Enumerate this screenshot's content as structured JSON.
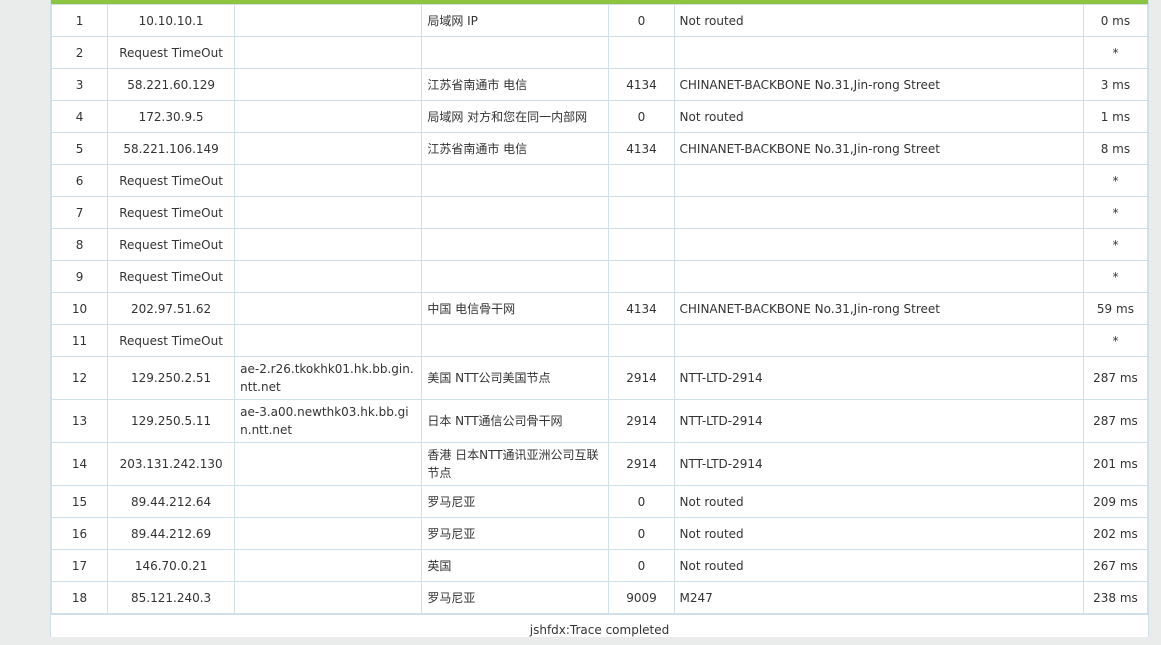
{
  "rows": [
    {
      "hop": "1",
      "ip": "10.10.10.1",
      "host": "",
      "location": "局域网 IP",
      "asn": "0",
      "network": "Not routed",
      "time": "0 ms"
    },
    {
      "hop": "2",
      "ip": "Request TimeOut",
      "host": "",
      "location": "",
      "asn": "",
      "network": "",
      "time": "*"
    },
    {
      "hop": "3",
      "ip": "58.221.60.129",
      "host": "",
      "location": "江苏省南通市 电信",
      "asn": "4134",
      "network": "CHINANET-BACKBONE No.31,Jin-rong Street",
      "time": "3 ms"
    },
    {
      "hop": "4",
      "ip": "172.30.9.5",
      "host": "",
      "location": "局域网 对方和您在同一内部网",
      "asn": "0",
      "network": "Not routed",
      "time": "1 ms"
    },
    {
      "hop": "5",
      "ip": "58.221.106.149",
      "host": "",
      "location": "江苏省南通市 电信",
      "asn": "4134",
      "network": "CHINANET-BACKBONE No.31,Jin-rong Street",
      "time": "8 ms"
    },
    {
      "hop": "6",
      "ip": "Request TimeOut",
      "host": "",
      "location": "",
      "asn": "",
      "network": "",
      "time": "*"
    },
    {
      "hop": "7",
      "ip": "Request TimeOut",
      "host": "",
      "location": "",
      "asn": "",
      "network": "",
      "time": "*"
    },
    {
      "hop": "8",
      "ip": "Request TimeOut",
      "host": "",
      "location": "",
      "asn": "",
      "network": "",
      "time": "*"
    },
    {
      "hop": "9",
      "ip": "Request TimeOut",
      "host": "",
      "location": "",
      "asn": "",
      "network": "",
      "time": "*"
    },
    {
      "hop": "10",
      "ip": "202.97.51.62",
      "host": "",
      "location": "中国 电信骨干网",
      "asn": "4134",
      "network": "CHINANET-BACKBONE No.31,Jin-rong Street",
      "time": "59 ms"
    },
    {
      "hop": "11",
      "ip": "Request TimeOut",
      "host": "",
      "location": "",
      "asn": "",
      "network": "",
      "time": "*"
    },
    {
      "hop": "12",
      "ip": "129.250.2.51",
      "host": "ae-2.r26.tkokhk01.hk.bb.gin.ntt.net",
      "location": "美国 NTT公司美国节点",
      "asn": "2914",
      "network": "NTT-LTD-2914",
      "time": "287 ms"
    },
    {
      "hop": "13",
      "ip": "129.250.5.11",
      "host": "ae-3.a00.newthk03.hk.bb.gin.ntt.net",
      "location": "日本 NTT通信公司骨干网",
      "asn": "2914",
      "network": "NTT-LTD-2914",
      "time": "287 ms"
    },
    {
      "hop": "14",
      "ip": "203.131.242.130",
      "host": "",
      "location": "香港 日本NTT通讯亚洲公司互联节点",
      "asn": "2914",
      "network": "NTT-LTD-2914",
      "time": "201 ms"
    },
    {
      "hop": "15",
      "ip": "89.44.212.64",
      "host": "",
      "location": "罗马尼亚",
      "asn": "0",
      "network": "Not routed",
      "time": "209 ms"
    },
    {
      "hop": "16",
      "ip": "89.44.212.69",
      "host": "",
      "location": "罗马尼亚",
      "asn": "0",
      "network": "Not routed",
      "time": "202 ms"
    },
    {
      "hop": "17",
      "ip": "146.70.0.21",
      "host": "",
      "location": "英国",
      "asn": "0",
      "network": "Not routed",
      "time": "267 ms"
    },
    {
      "hop": "18",
      "ip": "85.121.240.3",
      "host": "",
      "location": "罗马尼亚",
      "asn": "9009",
      "network": "M247",
      "time": "238 ms"
    }
  ],
  "footer": "jshfdx:Trace completed",
  "colors": {
    "accent": "#8cc43f",
    "border": "#cfe0ea",
    "background": "#e9ecea"
  }
}
